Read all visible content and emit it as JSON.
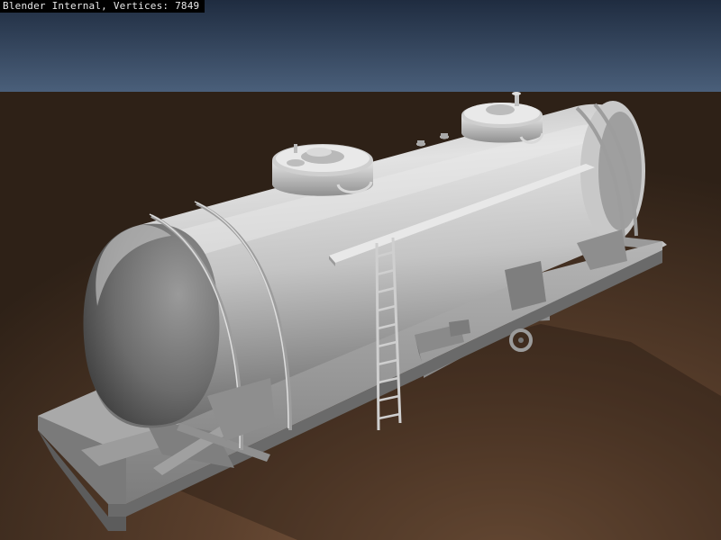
{
  "header": {
    "renderer": "Blender Internal",
    "vertices_label": "Vertices:",
    "vertices_count": "7849"
  },
  "scene": {
    "subject": "tank-car",
    "colors": {
      "sky_top": "#1f2c40",
      "sky_bottom": "#4a5f7a",
      "ground_far": "#3b2a1e",
      "ground_near": "#8a6346",
      "metal_light": "#d9d9d9",
      "metal_mid": "#a8a8a8",
      "metal_dark": "#5e5e5e"
    }
  }
}
